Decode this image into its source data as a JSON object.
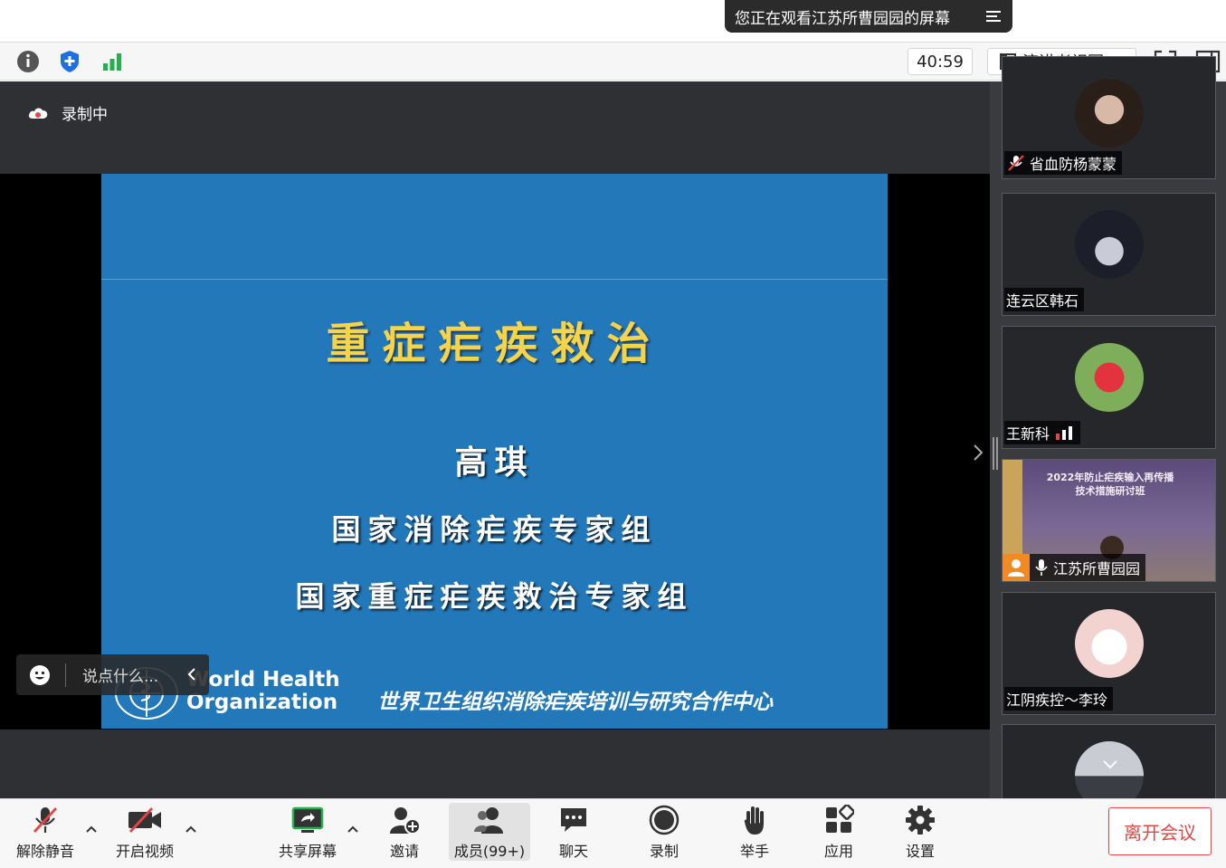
{
  "banner": {
    "text": "您正在观看江苏所曹园园的屏幕",
    "menu_icon": "list-menu-icon"
  },
  "topbar": {
    "timer": "40:59",
    "view_mode": "演讲者视图",
    "icons": [
      "info-icon",
      "shield-plus-icon",
      "signal-bars-icon",
      "fullscreen-icon",
      "sidebar-toggle-icon"
    ]
  },
  "main": {
    "recording_label": "录制中",
    "chat_placeholder": "说点什么...",
    "slide": {
      "title": "重症疟疾救治",
      "author": "高琪",
      "group1": "国家消除疟疾专家组",
      "group2": "国家重症疟疾救治专家组",
      "who_line1": "World Health",
      "who_line2": "Organization",
      "footer": "世界卫生组织消除疟疾培训与研究合作中心"
    }
  },
  "participants": [
    {
      "name": "省血防杨蒙蒙",
      "muted": true
    },
    {
      "name": "连云区韩石",
      "muted": false
    },
    {
      "name": "王新科",
      "muted": false,
      "speaking_bars": true
    },
    {
      "name": "江苏所曹园园",
      "muted": false,
      "sharing": true,
      "video_text_line1": "2022年防止疟疾输入再传播",
      "video_text_line2": "技术措施研讨班"
    },
    {
      "name": "江阴疾控～李玲",
      "muted": false
    },
    {
      "name": "",
      "muted": false
    }
  ],
  "bottombar": {
    "unmute": "解除静音",
    "video": "开启视频",
    "share": "共享屏幕",
    "invite": "邀请",
    "members": "成员(99+)",
    "chat": "聊天",
    "record": "录制",
    "raise_hand": "举手",
    "apps": "应用",
    "settings": "设置",
    "leave": "离开会议"
  },
  "colors": {
    "slide_bg": "#2278b8",
    "title_gold": "#f5d34a",
    "leave_red": "#e54545",
    "panel_bg": "#3a3b3f"
  }
}
